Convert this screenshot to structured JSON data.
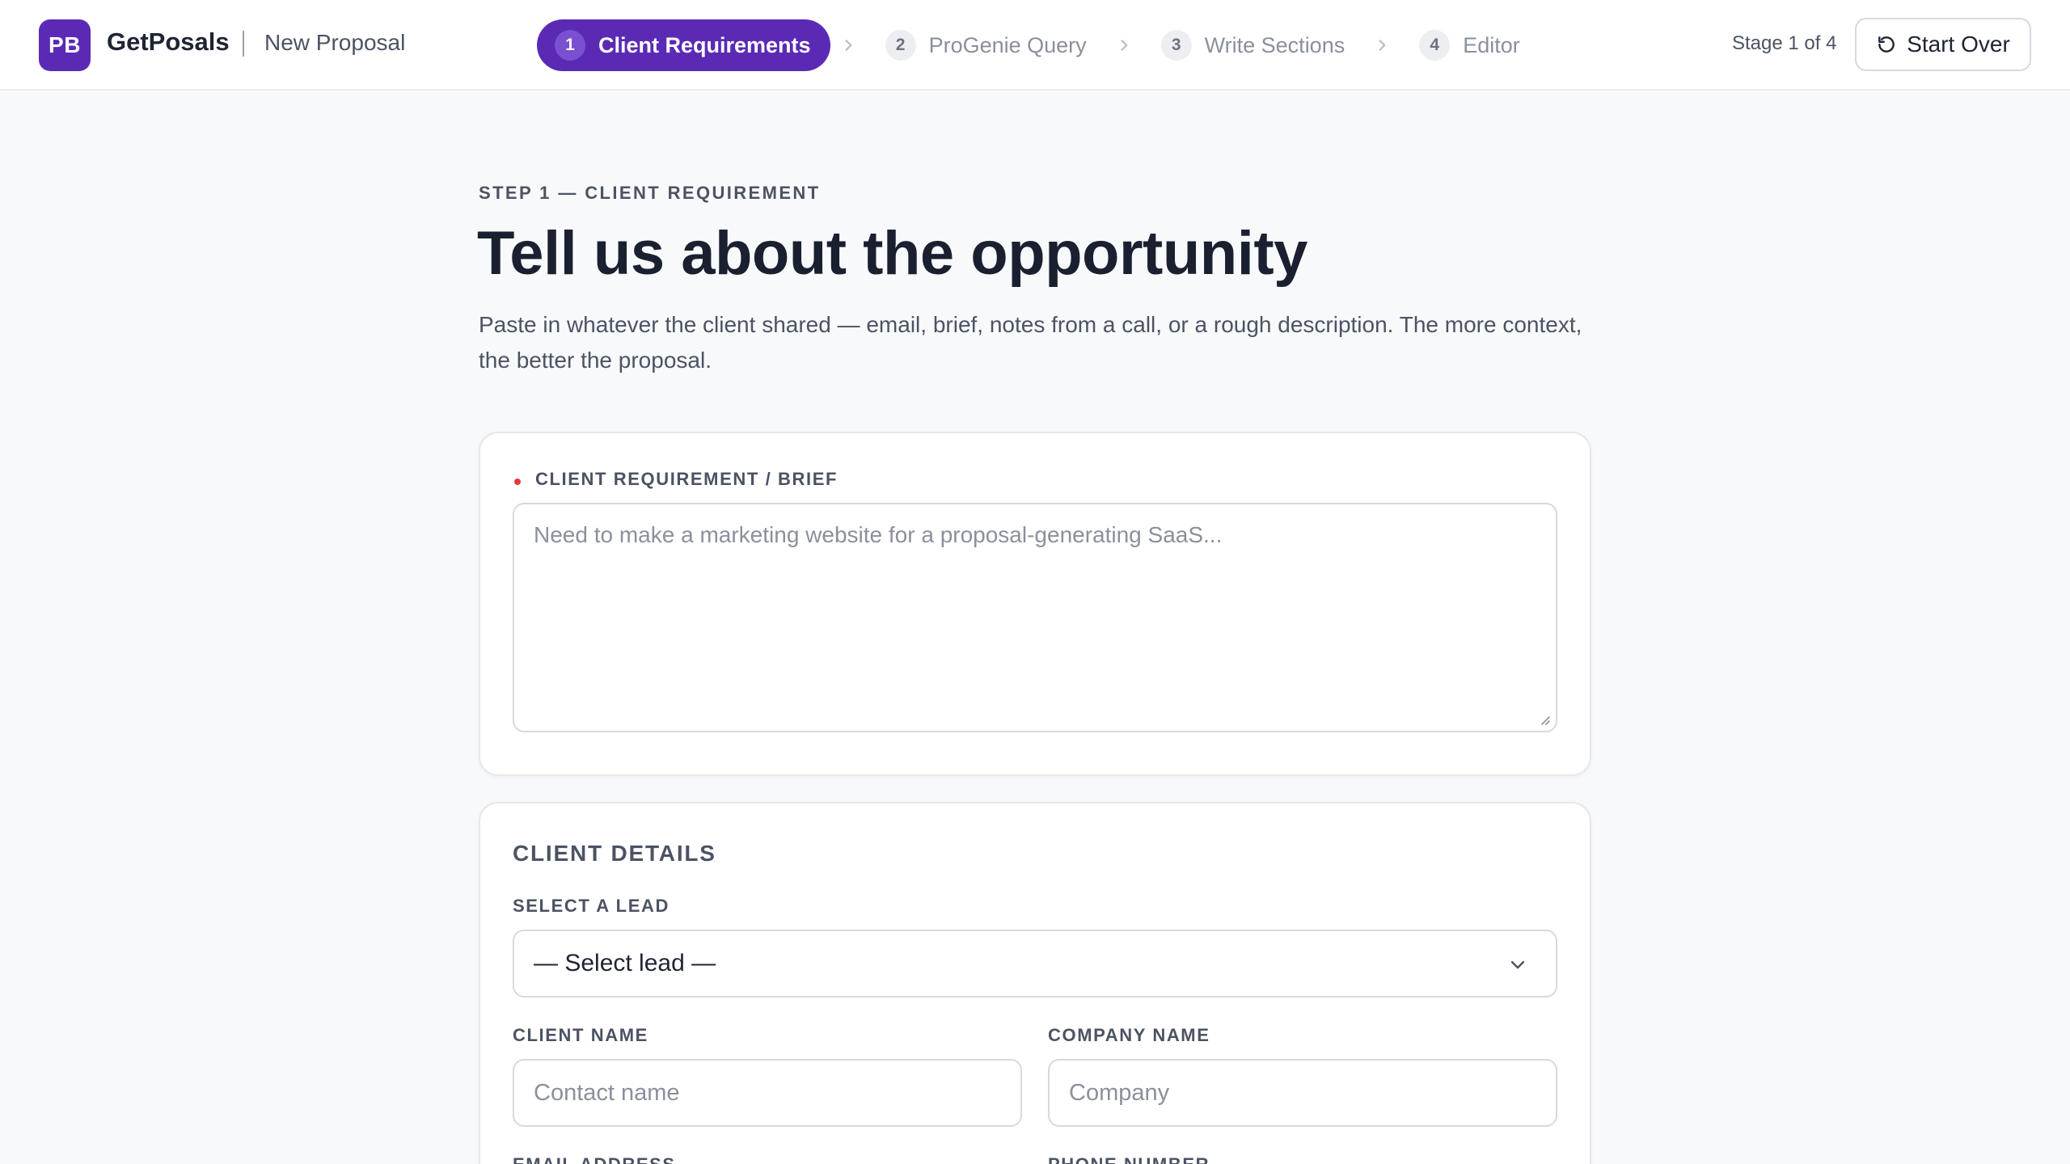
{
  "app": {
    "logo_initials": "PB",
    "name": "GetPosals",
    "page": "New Proposal"
  },
  "stepper": {
    "steps": [
      {
        "num": "1",
        "label": "Client Requirements",
        "active": true
      },
      {
        "num": "2",
        "label": "ProGenie Query",
        "active": false
      },
      {
        "num": "3",
        "label": "Write Sections",
        "active": false
      },
      {
        "num": "4",
        "label": "Editor",
        "active": false
      }
    ],
    "stage_label": "Stage 1 of 4",
    "start_over_label": "Start Over"
  },
  "intro": {
    "eyebrow": "STEP 1 — CLIENT REQUIREMENT",
    "title": "Tell us about the opportunity",
    "description": "Paste in whatever the client shared — email, brief, notes from a call, or a rough description. The more context, the better the proposal."
  },
  "requirement": {
    "label": "CLIENT REQUIREMENT / BRIEF",
    "placeholder": "Need to make a marketing website for a proposal-generating SaaS...",
    "value": ""
  },
  "client_details": {
    "title": "CLIENT DETAILS",
    "lead_label": "SELECT A LEAD",
    "lead_selected": "— Select lead —",
    "client_name_label": "CLIENT NAME",
    "client_name_placeholder": "Contact name",
    "company_name_label": "COMPANY NAME",
    "company_name_placeholder": "Company",
    "email_label": "EMAIL ADDRESS",
    "phone_label": "PHONE NUMBER"
  },
  "colors": {
    "brand": "#5b2ab5",
    "required": "#e03a3a",
    "background": "#f8f9fb"
  },
  "icons": {
    "start_over": "rotate-ccw-icon",
    "step_separator": "chevron-right-icon",
    "select_caret": "chevron-down-icon"
  }
}
